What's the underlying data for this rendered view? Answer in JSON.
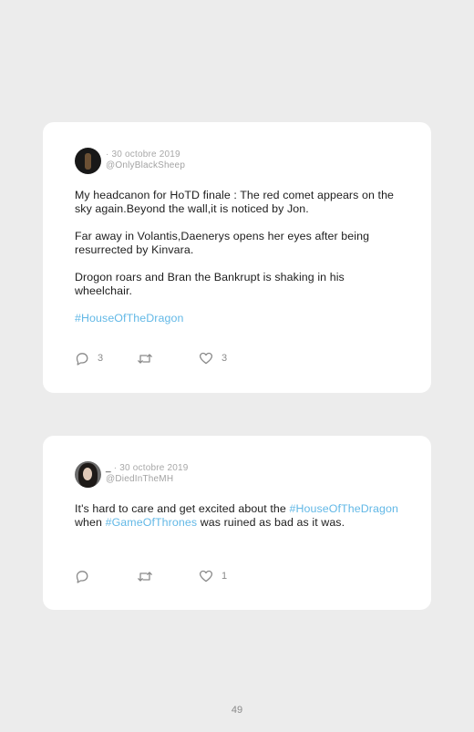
{
  "posts": [
    {
      "display_name": "",
      "date_line": "· 30 octobre 2019",
      "handle": "@OnlyBlackSheep",
      "paragraphs": [
        "My headcanon for HoTD finale : The red comet appears on the sky again.Beyond the wall,it is noticed by Jon.",
        "Far away in Volantis,Daenerys opens her eyes after being resurrected by Kinvara.",
        "Drogon roars and Bran the Bankrupt is shaking in his wheelchair."
      ],
      "hashtag": "#HouseOfTheDragon",
      "reply_count": "3",
      "retweet_count": "",
      "like_count": "3"
    },
    {
      "display_name": "_",
      "date_line": " · 30 octobre 2019",
      "handle": "@DiedInTheMH",
      "text_before": "It's hard to care and get excited about the ",
      "hashtag_1": "#HouseOfTheDragon",
      "text_middle": " when ",
      "hashtag_2": "#GameOfThrones",
      "text_after": " was ruined as bad as it was.",
      "reply_count": "",
      "retweet_count": "",
      "like_count": "1"
    }
  ],
  "page_number": "49",
  "colors": {
    "background": "#ececec",
    "card": "#ffffff",
    "hashtag": "#62b8e6",
    "icon": "#8a8a8a"
  },
  "icons": [
    "reply-icon",
    "retweet-icon",
    "heart-icon"
  ]
}
